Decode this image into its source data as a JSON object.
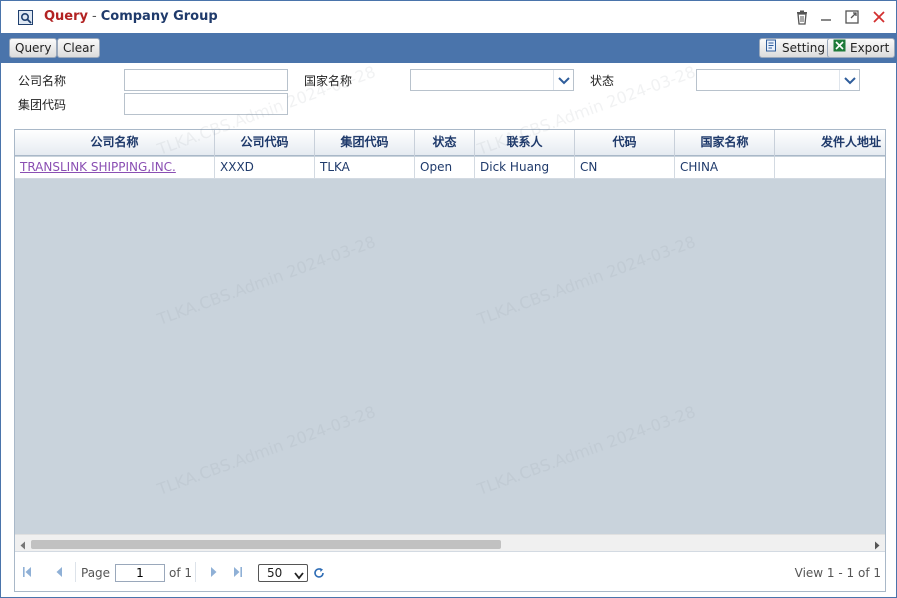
{
  "window": {
    "title_main": "Query",
    "title_sep": "-",
    "title_sub": "Company Group"
  },
  "toolbar": {
    "query_label": "Query",
    "clear_label": "Clear",
    "setting_label": "Setting",
    "export_label": "Export"
  },
  "form": {
    "company_name_label": "公司名称",
    "country_name_label": "国家名称",
    "status_label": "状态",
    "group_code_label": "集团代码",
    "company_name_value": "",
    "group_code_value": "",
    "country_name_value": "",
    "status_value": ""
  },
  "grid": {
    "columns": [
      "公司名称",
      "公司代码",
      "集团代码",
      "状态",
      "联系人",
      "代码",
      "国家名称",
      "发件人地址"
    ],
    "rows": [
      [
        "TRANSLINK SHIPPING,INC.",
        "XXXD",
        "TLKA",
        "Open",
        "Dick Huang",
        "CN",
        "CHINA",
        ""
      ]
    ]
  },
  "pager": {
    "page_label": "Page",
    "page_value": "1",
    "of_label": "of 1",
    "page_size": "50",
    "view_text": "View 1 - 1 of 1"
  },
  "watermark": "TLKA.CBS.Admin 2024-03-28",
  "colors": {
    "toolbar_bg": "#4a74ab",
    "title_accent": "#b22222",
    "title_text": "#1f3a6b",
    "link": "#8a4fb3",
    "grid_bg": "#c9d3dc"
  }
}
